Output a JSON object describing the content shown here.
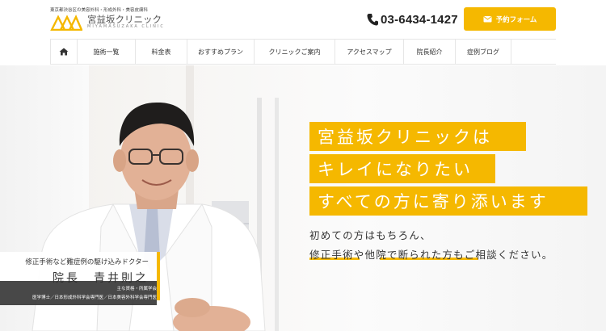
{
  "header": {
    "tagline": "東京都渋谷区の美容外科・形成外科・美容皮膚科",
    "logo_name": "宮益坂クリニック",
    "logo_sub": "MIYAMASUZAKA CLINIC",
    "phone": "03-6434-1427",
    "reserve_label": "予約フォーム"
  },
  "nav": {
    "home_icon": "home-icon",
    "items": [
      {
        "label": "施術一覧"
      },
      {
        "label": "料金表"
      },
      {
        "label": "おすすめプラン"
      },
      {
        "label": "クリニックご案内"
      },
      {
        "label": "アクセスマップ"
      },
      {
        "label": "院長紹介"
      },
      {
        "label": "症例ブログ"
      }
    ]
  },
  "hero": {
    "headline": [
      "宮益坂クリニックは",
      "キレイになりたい",
      "すべての方に寄り添います"
    ],
    "sub": [
      "初めての方はもちろん、",
      "修正手術や他院で断られた方もご相談ください。"
    ],
    "doctor_role": "修正手術など難症例の駆け込みドクター",
    "doctor_name": "院長　青井則之",
    "credentials_title": "主な資格・所属学会",
    "credentials": "医学博士／日本形成外科学会専門医／日本美容外科学会専門医"
  },
  "colors": {
    "accent": "#f5b800",
    "text": "#333333",
    "dark_bar": "#2f2f2f"
  }
}
